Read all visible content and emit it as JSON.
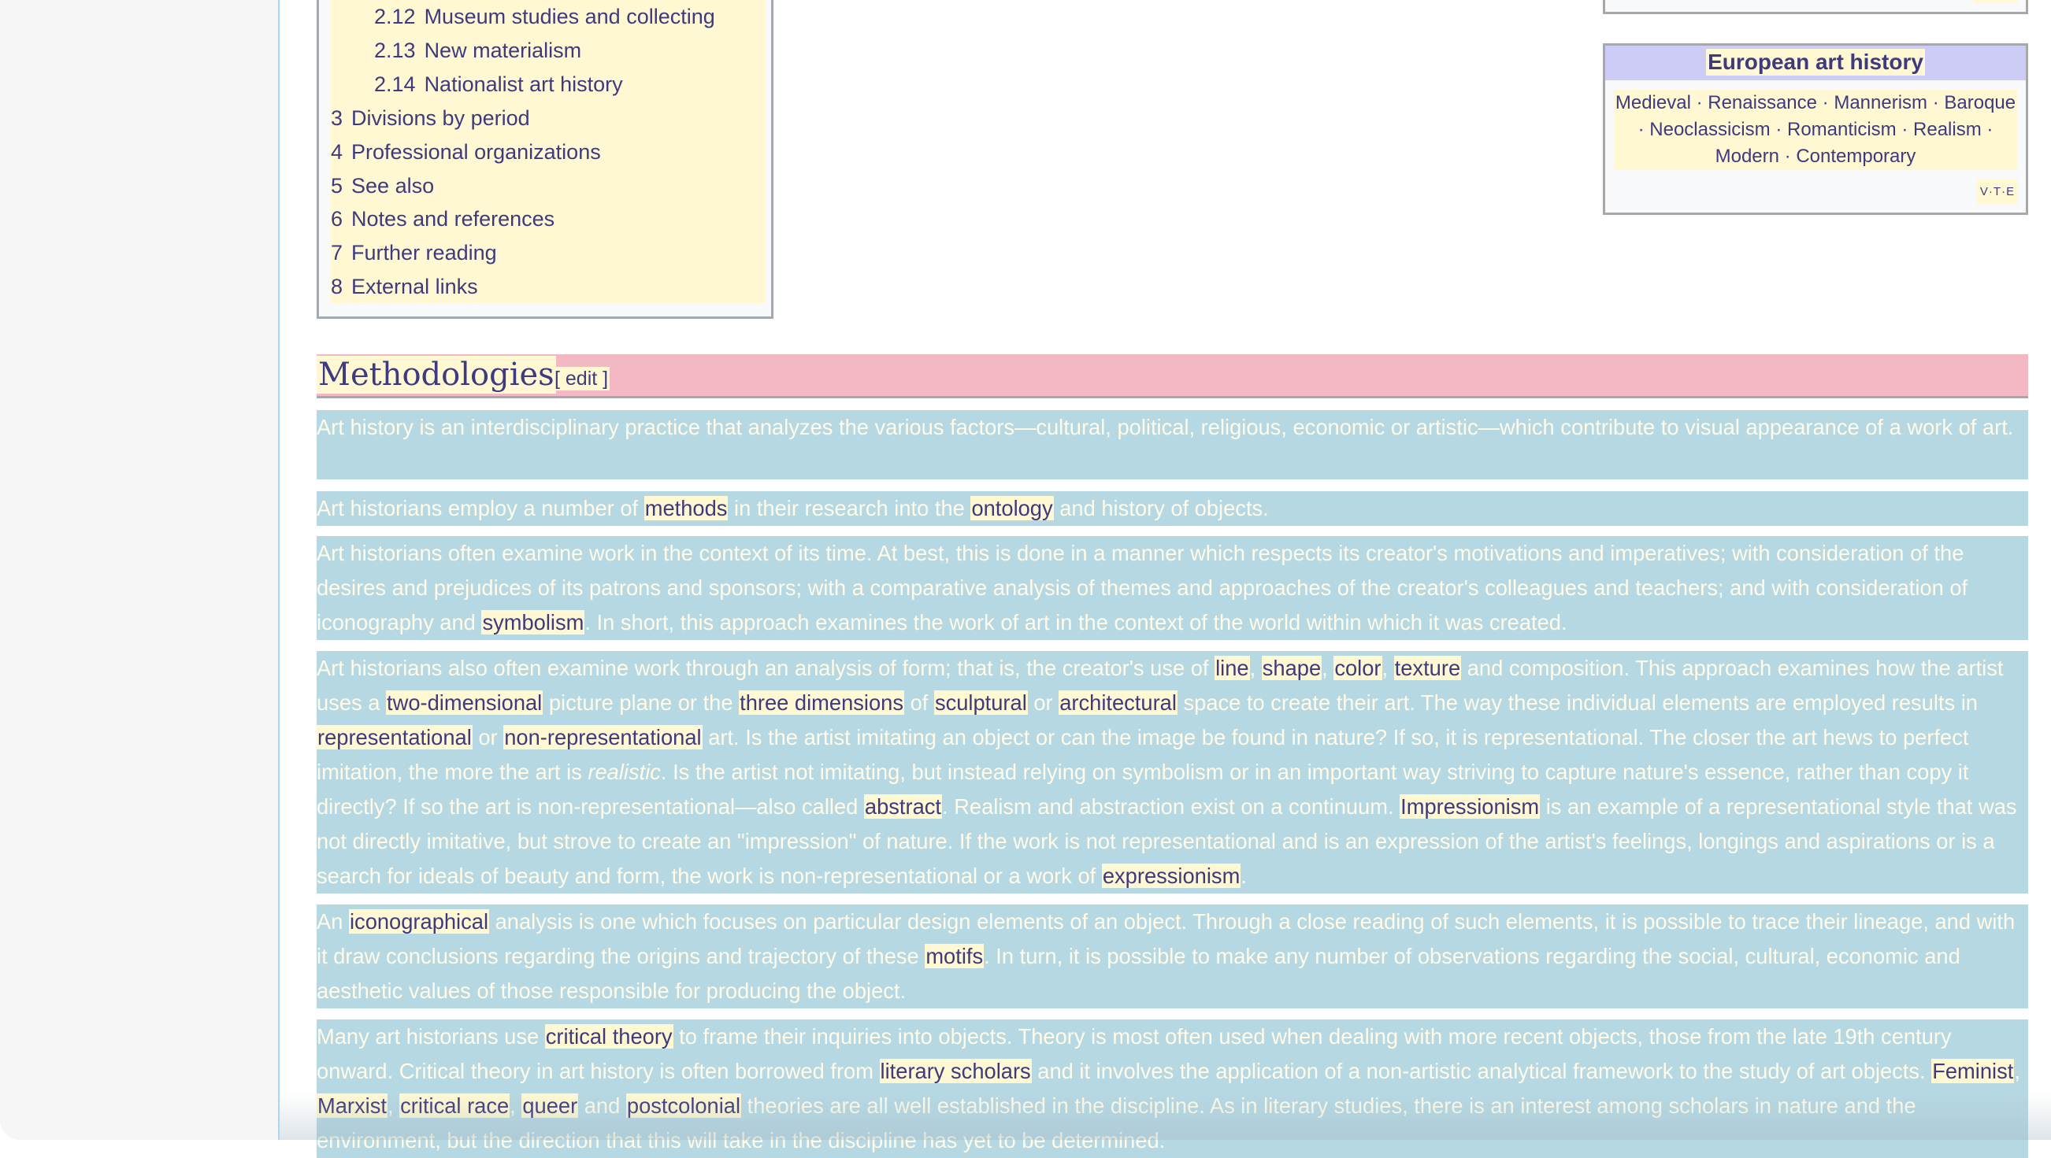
{
  "toc": {
    "items": [
      {
        "num": "2.12",
        "label": "Museum studies and collecting",
        "level": 2
      },
      {
        "num": "2.13",
        "label": "New materialism",
        "level": 2
      },
      {
        "num": "2.14",
        "label": "Nationalist art history",
        "level": 2
      },
      {
        "num": "3",
        "label": "Divisions by period",
        "level": 1
      },
      {
        "num": "4",
        "label": "Professional organizations",
        "level": 1
      },
      {
        "num": "5",
        "label": "See also",
        "level": 1
      },
      {
        "num": "6",
        "label": "Notes and references",
        "level": 1
      },
      {
        "num": "7",
        "label": "Further reading",
        "level": 1
      },
      {
        "num": "8",
        "label": "External links",
        "level": 1
      }
    ]
  },
  "navbox": {
    "title": "European art history",
    "items": [
      "Medieval",
      "Renaissance",
      "Mannerism",
      "Baroque",
      "Neoclassicism",
      "Romanticism",
      "Realism",
      "Modern",
      "Contemporary"
    ],
    "separator": "·",
    "vte": {
      "v": "V",
      "t": "T",
      "e": "E"
    }
  },
  "section": {
    "title": "Methodologies",
    "edit_label": "[ edit ]"
  },
  "paragraphs": {
    "p1": {
      "text": "Art history is an interdisciplinary practice that analyzes the various factors—cultural, political, religious, economic or artistic—which contribute to visual appearance of a work of art."
    },
    "p2": {
      "t0": "Art historians employ a number of ",
      "l0": "methods",
      "t1": " in their research into the ",
      "l1": "ontology",
      "t2": " and history of objects."
    },
    "p3": {
      "t0": "Art historians often examine work in the context of its time. At best, this is done in a manner which respects its creator's motivations and imperatives; with consideration of the desires and prejudices of its patrons and sponsors; with a comparative analysis of themes and approaches of the creator's colleagues and teachers; and with consideration of iconography and ",
      "l0": "symbolism",
      "t1": ". In short, this approach examines the work of art in the context of the world within which it was created."
    },
    "p4": {
      "t0": "Art historians also often examine work through an analysis of form; that is, the creator's use of ",
      "l0": "line",
      "t1": ", ",
      "l1": "shape",
      "t2": ", ",
      "l2": "color",
      "t3": ", ",
      "l3": "texture",
      "t4": " and composition. This approach examines how the artist uses a ",
      "l4": "two-dimensional",
      "t5": " picture plane or the ",
      "l5": "three dimensions",
      "t6": " of ",
      "l6": "sculptural",
      "t7": " or ",
      "l7": "architectural",
      "t8": " space to create their art. The way these individual elements are employed results in ",
      "l8": "representational",
      "t9": " or ",
      "l9": "non-representational",
      "t10": " art. Is the artist imitating an object or can the image be found in nature? If so, it is representational. The closer the art hews to perfect imitation, the more the art is ",
      "em": "realistic",
      "t11": ". Is the artist not imitating, but instead relying on symbolism or in an important way striving to capture nature's essence, rather than copy it directly? If so the art is non-representational—also called ",
      "l10": "abstract",
      "t12": ". Realism and abstraction exist on a continuum. ",
      "l11": "Impressionism",
      "t13": " is an example of a representational style that was not directly imitative, but strove to create an \"impression\" of nature. If the work is not representational and is an expression of the artist's feelings, longings and aspirations or is a search for ideals of beauty and form, the work is non-representational or a work of ",
      "l12": "expressionism",
      "t14": "."
    },
    "p5": {
      "t0": "An ",
      "l0": "iconographical",
      "t1": " analysis is one which focuses on particular design elements of an object. Through a close reading of such elements, it is possible to trace their lineage, and with it draw conclusions regarding the origins and trajectory of these ",
      "l1": "motifs",
      "t2": ". In turn, it is possible to make any number of observations regarding the social, cultural, economic and aesthetic values of those responsible for producing the object."
    },
    "p6": {
      "t0": "Many art historians use ",
      "l0": "critical theory",
      "t1": " to frame their inquiries into objects. Theory is most often used when dealing with more recent objects, those from the late 19th century onward. Critical theory in art history is often borrowed from ",
      "l1": "literary scholars",
      "t2": " and it involves the application of a non-artistic analytical framework to the study of art objects. ",
      "l2": "Feminist",
      "t3": ", ",
      "l3": "Marxist",
      "t4": ", ",
      "l4": "critical race",
      "t5": ", ",
      "l5": "queer",
      "t6": " and ",
      "l6": "postcolonial",
      "t7": " theories are all well established in the discipline. As in literary studies, there is an interest among scholars in nature and the environment, but the direction that this will take in the discipline has yet to be determined."
    }
  },
  "colors": {
    "link": "#3d3a80",
    "highlight": "#fff8d2",
    "paragraph_bg": "#b6d8e3",
    "heading_bg": "#f4b8c4",
    "navbox_header_bg": "#ccccf7"
  }
}
